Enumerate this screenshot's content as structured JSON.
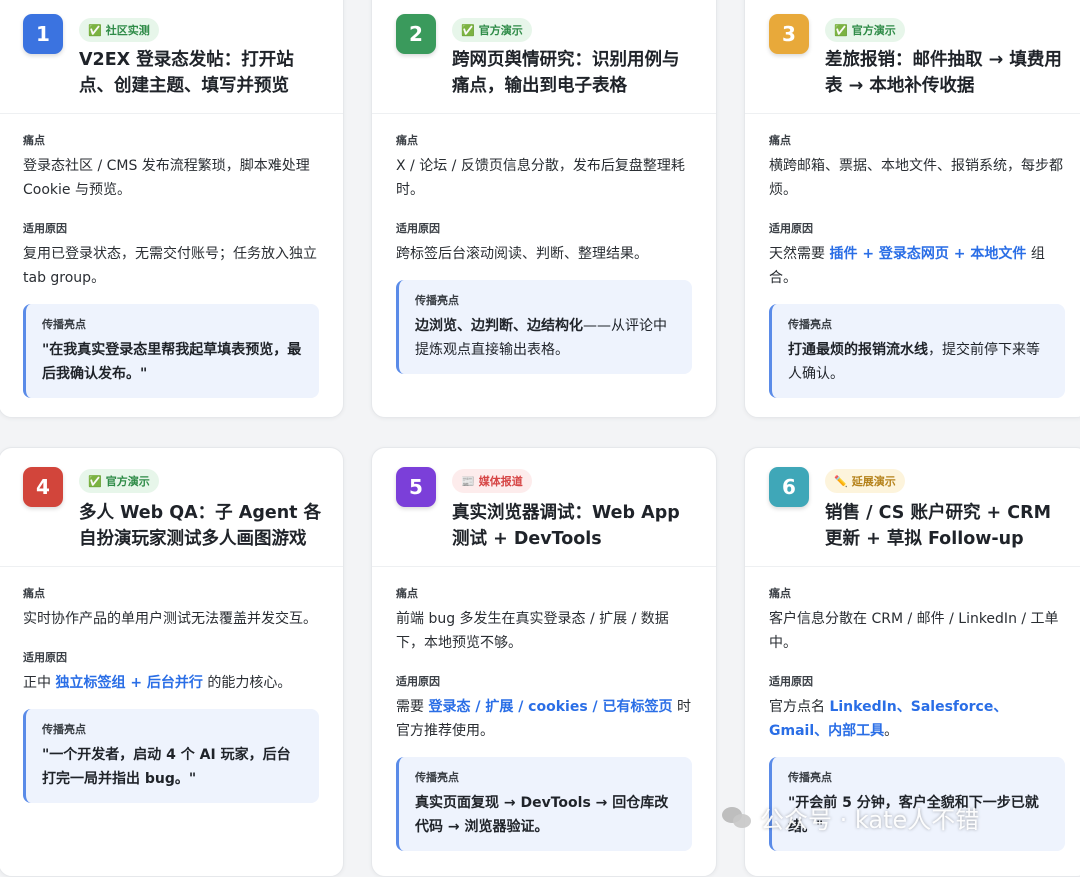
{
  "cards": [
    {
      "number": "1",
      "num_color": "#3b73e0",
      "badge": {
        "icon": "✅",
        "text": "社区实测",
        "style": "green"
      },
      "title": "V2EX 登录态发帖：打开站点、创建主题、填写并预览",
      "pain_label": "痛点",
      "pain_text": "登录态社区 / CMS 发布流程繁琐，脚本难处理 Cookie 与预览。",
      "reason_label": "适用原因",
      "reason_parts": [
        "复用已登录状态，无需交付账号；任务放入独立 tab group。"
      ],
      "highlight_label": "传播亮点",
      "highlight_parts": [
        "\"在我真实登录态里帮我起草填表预览，最后我确认发布。\""
      ]
    },
    {
      "number": "2",
      "num_color": "#3a9a5c",
      "badge": {
        "icon": "✅",
        "text": "官方演示",
        "style": "green"
      },
      "title": "跨网页舆情研究：识别用例与痛点，输出到电子表格",
      "pain_label": "痛点",
      "pain_text": "X / 论坛 / 反馈页信息分散，发布后复盘整理耗时。",
      "reason_label": "适用原因",
      "reason_parts": [
        "跨标签后台滚动阅读、判断、整理结果。"
      ],
      "highlight_label": "传播亮点",
      "highlight_parts": [
        "边浏览、边判断、边结构化",
        "——从评论中提炼观点直接输出表格。"
      ]
    },
    {
      "number": "3",
      "num_color": "#e8a93a",
      "badge": {
        "icon": "✅",
        "text": "官方演示",
        "style": "green"
      },
      "title": "差旅报销：邮件抽取 → 填费用表 → 本地补传收据",
      "pain_label": "痛点",
      "pain_text": "横跨邮箱、票据、本地文件、报销系统，每步都烦。",
      "reason_label": "适用原因",
      "reason_parts": [
        "天然需要 ",
        "插件 + 登录态网页 + 本地文件",
        " 组合。"
      ],
      "highlight_label": "传播亮点",
      "highlight_parts": [
        "打通最烦的报销流水线",
        "，提交前停下来等人确认。"
      ]
    },
    {
      "number": "4",
      "num_color": "#d2453b",
      "badge": {
        "icon": "✅",
        "text": "官方演示",
        "style": "green"
      },
      "title": "多人 Web QA：子 Agent 各自扮演玩家测试多人画图游戏",
      "pain_label": "痛点",
      "pain_text": "实时协作产品的单用户测试无法覆盖并发交互。",
      "reason_label": "适用原因",
      "reason_parts": [
        "正中 ",
        "独立标签组 + 后台并行",
        " 的能力核心。"
      ],
      "highlight_label": "传播亮点",
      "highlight_parts": [
        "\"一个开发者，启动 4 个 AI 玩家，后台打完一局并指出 bug。\""
      ]
    },
    {
      "number": "5",
      "num_color": "#7b3fd9",
      "badge": {
        "icon": "📰",
        "text": "媒体报道",
        "style": "red"
      },
      "title": "真实浏览器调试：Web App 测试 + DevTools",
      "pain_label": "痛点",
      "pain_text": "前端 bug 多发生在真实登录态 / 扩展 / 数据下，本地预览不够。",
      "reason_label": "适用原因",
      "reason_parts": [
        "需要 ",
        "登录态 / 扩展 / cookies / 已有标签页",
        " 时官方推荐使用。"
      ],
      "highlight_label": "传播亮点",
      "highlight_parts": [
        "真实页面复现 → DevTools → 回仓库改代码 → 浏览器验证。"
      ]
    },
    {
      "number": "6",
      "num_color": "#3fa7b8",
      "badge": {
        "icon": "✏️",
        "text": "延展演示",
        "style": "yellow"
      },
      "title": "销售 / CS 账户研究 + CRM 更新 + 草拟 Follow-up",
      "pain_label": "痛点",
      "pain_text": "客户信息分散在 CRM / 邮件 / LinkedIn / 工单中。",
      "reason_label": "适用原因",
      "reason_parts": [
        "官方点名 ",
        "LinkedIn、Salesforce、Gmail、内部工具",
        "。"
      ],
      "highlight_label": "传播亮点",
      "highlight_parts": [
        "\"开会前 5 分钟，客户全貌和下一步已就绪。\""
      ]
    }
  ],
  "watermark": {
    "text": "公众号 · kate人不错"
  }
}
